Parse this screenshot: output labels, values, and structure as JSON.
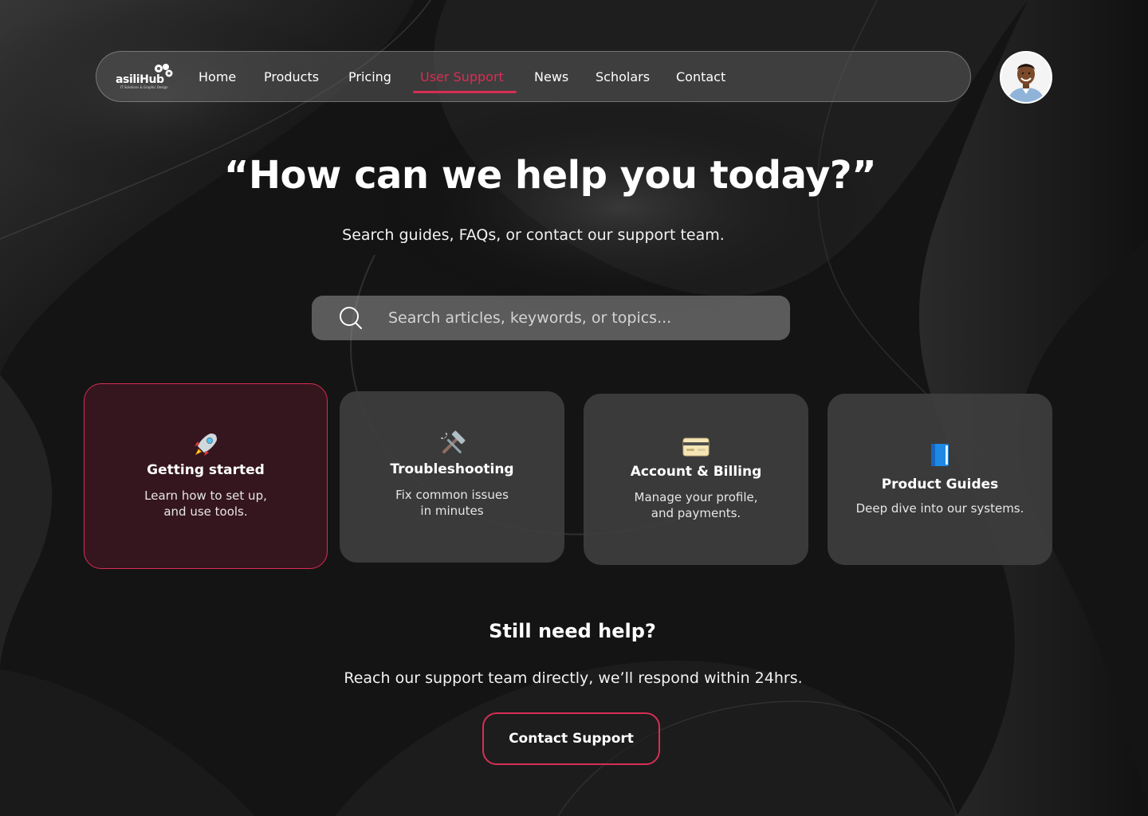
{
  "nav": {
    "logo": {
      "word": "asiliHub",
      "tagline": "IT Solutions & Graphic Design"
    },
    "items": [
      {
        "label": "Home",
        "active": false
      },
      {
        "label": "Products",
        "active": false
      },
      {
        "label": "Pricing",
        "active": false
      },
      {
        "label": "User Support",
        "active": true
      },
      {
        "label": "News",
        "active": false
      },
      {
        "label": "Scholars",
        "active": false
      },
      {
        "label": "Contact",
        "active": false
      }
    ]
  },
  "user": {
    "avatar": "avatar-photo"
  },
  "hero": {
    "title": "“How can we help you today?”",
    "subtitle": "Search guides, FAQs, or contact our support team."
  },
  "search": {
    "icon": "search-icon",
    "placeholder": "Search articles, keywords, or topics...",
    "value": ""
  },
  "cards": [
    {
      "icon": "rocket-icon",
      "title": "Getting started",
      "description": "Learn how to set up,\nand use tools.",
      "selected": true
    },
    {
      "icon": "tools-icon",
      "title": "Troubleshooting",
      "description": "Fix common issues\n in minutes",
      "selected": false
    },
    {
      "icon": "credit-card-icon",
      "title": "Account & Billing",
      "description": "Manage your profile,\nand payments.",
      "selected": false
    },
    {
      "icon": "book-icon",
      "title": "Product Guides",
      "description": "Deep dive into our systems.",
      "selected": false
    }
  ],
  "help": {
    "title": "Still need help?",
    "subtitle": "Reach our support team directly, we’ll respond within 24hrs.",
    "button_label": "Contact Support"
  },
  "colors": {
    "accent": "#d72e55",
    "background": "#161616",
    "card": "#3e3e3e",
    "card_selected": "#3a1620"
  }
}
